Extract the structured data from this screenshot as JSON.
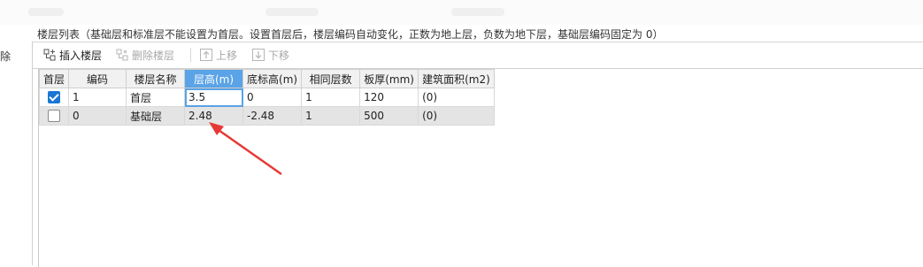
{
  "caption": "楼层列表（基础层和标准层不能设置为首层。设置首层后，楼层编码自动变化，正数为地上层，负数为地下层，基础层编码固定为 0）",
  "left_fragment": "除",
  "toolbar": {
    "insert_label": "插入楼层",
    "delete_label": "删除楼层",
    "up_label": "上移",
    "down_label": "下移"
  },
  "columns": [
    "首层",
    "编码",
    "楼层名称",
    "层高(m)",
    "底标高(m)",
    "相同层数",
    "板厚(mm)",
    "建筑面积(m2)"
  ],
  "rows": [
    {
      "first_floor": true,
      "code": "1",
      "name": "首层",
      "height": "3.5",
      "bottom": "0",
      "count": "1",
      "thickness": "120",
      "area": "(0)"
    },
    {
      "first_floor": false,
      "code": "0",
      "name": "基础层",
      "height": "2.48",
      "bottom": "-2.48",
      "count": "1",
      "thickness": "500",
      "area": "(0)"
    }
  ],
  "colors": {
    "accent": "#5aa3e6",
    "checkbox": "#1976d2",
    "arrow": "#e53935"
  }
}
